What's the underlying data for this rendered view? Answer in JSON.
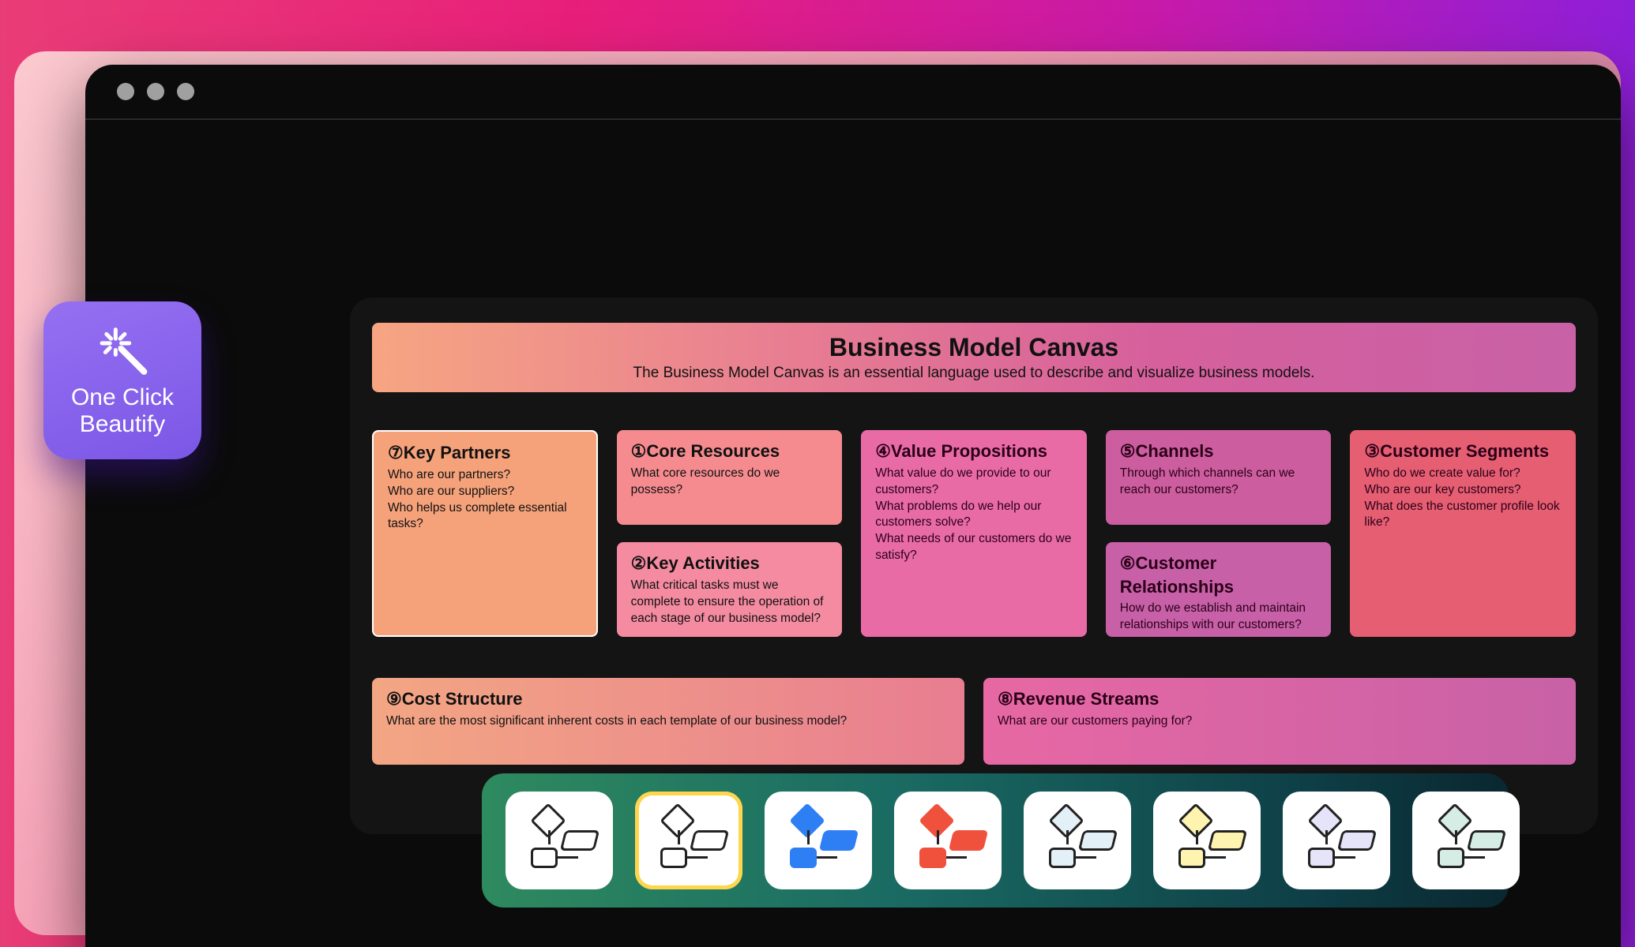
{
  "beautify": {
    "label": "One Click\nBeautify"
  },
  "banner": {
    "title": "Business Model Canvas",
    "subtitle": "The Business Model Canvas is an essential language used to describe and visualize business models."
  },
  "cards": {
    "partners": {
      "title": "⑦Key Partners",
      "body": "Who are our partners?\nWho are our suppliers?\nWho helps us complete essential tasks?"
    },
    "core": {
      "title": "①Core Resources",
      "body": "What core resources do we possess?"
    },
    "activities": {
      "title": "②Key Activities",
      "body": "What critical tasks must we complete to ensure the operation of each stage of our business model?"
    },
    "value": {
      "title": "④Value Propositions",
      "body": "What value do we provide to our customers?\nWhat problems do we help our customers solve?\nWhat needs of our customers do we satisfy?"
    },
    "channels": {
      "title": "⑤Channels",
      "body": "Through which channels can we reach our customers?"
    },
    "custrel": {
      "title": "⑥Customer Relationships",
      "body": "How do we establish and maintain relationships with our customers?"
    },
    "segments": {
      "title": "③Customer Segments",
      "body": "Who do we create value for?\nWho are our key customers?\nWhat does the customer profile look like?"
    },
    "cost": {
      "title": "⑨Cost Structure",
      "body": "What are the most significant inherent costs in each template of our business model?"
    },
    "revenue": {
      "title": "⑧Revenue Streams",
      "body": "What are our customers paying for?"
    }
  },
  "themes": [
    {
      "name": "outline-1"
    },
    {
      "name": "outline-2"
    },
    {
      "name": "blue"
    },
    {
      "name": "red"
    },
    {
      "name": "ice"
    },
    {
      "name": "yellow"
    },
    {
      "name": "lavender"
    },
    {
      "name": "mint"
    }
  ]
}
